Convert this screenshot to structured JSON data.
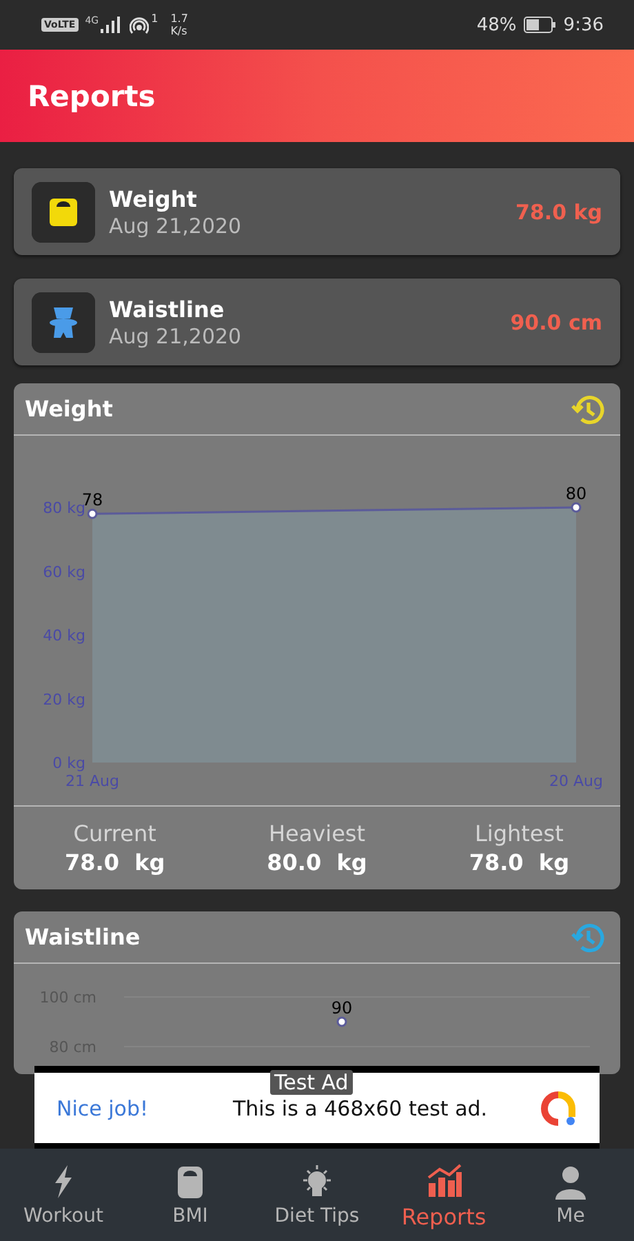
{
  "status_bar": {
    "badge": "VoLTE",
    "network": "4G",
    "hotspot_count": "1",
    "speed": [
      "1.7",
      "K/s"
    ],
    "battery": "48%",
    "time": "9:36"
  },
  "header": {
    "title": "Reports"
  },
  "summary_cards": [
    {
      "kind": "weight",
      "title": "Weight",
      "date": "Aug 21,2020",
      "value": "78.0 kg"
    },
    {
      "kind": "waist",
      "title": "Waistline",
      "date": "Aug 21,2020",
      "value": "90.0 cm"
    }
  ],
  "panels": [
    {
      "title": "Weight",
      "color": "#e8d52a",
      "chart_data": {
        "type": "area",
        "categories": [
          "21 Aug",
          "20 Aug"
        ],
        "values": [
          78,
          80
        ],
        "marker": "circle",
        "ylim": [
          0,
          80
        ],
        "yticks": [
          {
            "value": 0,
            "label": "0 kg"
          },
          {
            "value": 20,
            "label": "20 kg"
          },
          {
            "value": 40,
            "label": "40 kg"
          },
          {
            "value": 60,
            "label": "60 kg"
          },
          {
            "value": 80,
            "label": "80 kg"
          }
        ],
        "data_labels": true
      },
      "stats": [
        {
          "label": "Current",
          "value": "78.0  kg"
        },
        {
          "label": "Heaviest",
          "value": "80.0  kg"
        },
        {
          "label": "Lightest",
          "value": "78.0  kg"
        }
      ]
    },
    {
      "title": "Waistline",
      "color": "#29a8e0",
      "chart_data": {
        "type": "line",
        "values": [
          90
        ],
        "marker": "circle",
        "ylim": [
          80,
          100
        ],
        "yticks": [
          {
            "value": 80,
            "label": "80 cm"
          },
          {
            "value": 100,
            "label": "100 cm"
          }
        ],
        "data_labels": true
      }
    }
  ],
  "ad": {
    "tag": "Test Ad",
    "headline": "Nice job!",
    "text": "This is a 468x60 test ad."
  },
  "nav": [
    {
      "kind": "workout",
      "label": "Workout",
      "selected": false
    },
    {
      "kind": "bmi",
      "label": "BMI",
      "selected": false
    },
    {
      "kind": "tips",
      "label": "Diet Tips",
      "selected": false
    },
    {
      "kind": "reports",
      "label": "Reports",
      "selected": true
    },
    {
      "kind": "me",
      "label": "Me",
      "selected": false
    }
  ]
}
